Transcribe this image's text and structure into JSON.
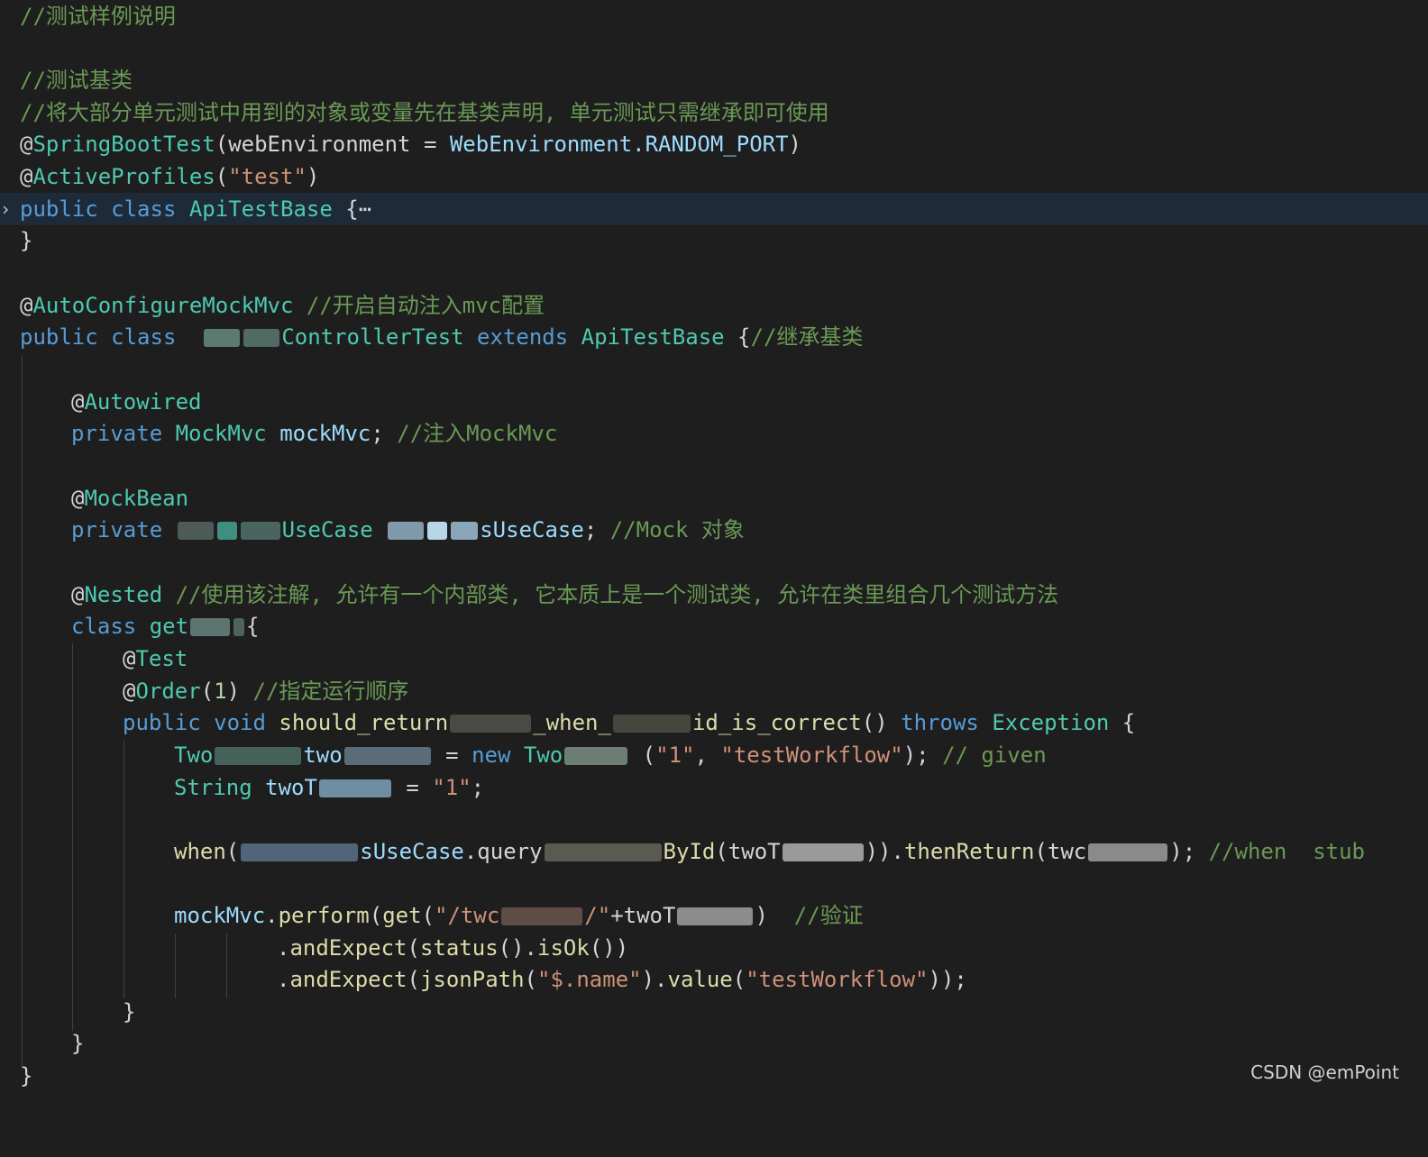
{
  "code_lines": {
    "l1": "//测试样例说明",
    "l3": "//测试基类",
    "l4": "//将大部分单元测试中用到的对象或变量先在基类声明, 单元测试只需继承即可使用",
    "l5": {
      "at": "@",
      "ann": "SpringBootTest",
      "a": "(",
      "b": "webEnvironment",
      "c": " = ",
      "d": "WebEnvironment",
      "e": ".RANDOM_PORT",
      "f": ")"
    },
    "l6": {
      "at": "@",
      "ann": "ActiveProfiles",
      "a": "(",
      "b": "\"test\"",
      "c": ")"
    },
    "l7": {
      "a": "public",
      "b": " ",
      "c": "class",
      "d": " ",
      "e": "ApiTestBase",
      "f": " {",
      "g": "⋯"
    },
    "l8": "}",
    "l10": {
      "at": "@",
      "ann": "AutoConfigureMockMvc",
      "c": " //开启自动注入mvc配置"
    },
    "l11": {
      "a": "public",
      "b": " ",
      "c": "class",
      "e": "ControllerTest",
      "f": " extends ",
      "g": "ApiTestBase",
      "h": " {",
      "i": "//继承基类"
    },
    "l13": {
      "at": "@",
      "ann": "Autowired"
    },
    "l14": {
      "a": "private",
      "b": " ",
      "c": "MockMvc",
      "d": " mockMvc",
      "e": ";",
      "f": " //注入MockMvc"
    },
    "l16": {
      "at": "@",
      "ann": "MockBean"
    },
    "l17": {
      "a": "private",
      "b": "UseCase",
      "c": "sUseCase",
      "d": ";",
      "e": " //Mock 对象"
    },
    "l19": {
      "at": "@",
      "ann": "Nested",
      "c": " //使用该注解, 允许有一个内部类, 它本质上是一个测试类, 允许在类里组合几个测试方法"
    },
    "l20": {
      "a": "class",
      "b": " get",
      "c": "{"
    },
    "l21": {
      "at": "@",
      "ann": "Test"
    },
    "l22": {
      "at": "@",
      "ann": "Order",
      "a": "(",
      "b": "1",
      "c": ")",
      "d": " //指定运行顺序"
    },
    "l23": {
      "a": "public",
      "b": " ",
      "c": "void",
      "d": " should_return",
      "e": "_when_",
      "f": "id_is_correct",
      "g": "() ",
      "h": "throws",
      "i": " ",
      "j": "Exception",
      "k": " {"
    },
    "l24": {
      "a": "Two",
      "b": "two",
      "c": " = ",
      "d": "new",
      "e": " Two",
      "f": " (",
      "g": "\"1\"",
      "h": ", ",
      "i": "\"testWorkflow\"",
      "j": "); ",
      "k": "// given"
    },
    "l25": {
      "a": "String",
      "b": " twoT",
      "c": " = ",
      "d": "\"1\"",
      "e": ";"
    },
    "l27": {
      "a": "when",
      "b": "(",
      "c": "sUseCase",
      "d": ".query",
      "e": "ById",
      "f": "(twoT",
      "g": ")).",
      "h": "thenReturn",
      "i": "(twc",
      "j": "); ",
      "k": "//when  stub"
    },
    "l29": {
      "a": "mockMvc",
      "b": ".",
      "c": "perform",
      "d": "(",
      "e": "get",
      "f": "(",
      "g": "\"/twc",
      "h": "/\"",
      "i": "+twoT",
      "j": ")",
      "k": "  //验证"
    },
    "l30": {
      "a": ".",
      "b": "andExpect",
      "c": "(",
      "d": "status",
      "e": "().",
      "f": "isOk",
      "g": "())"
    },
    "l31": {
      "a": ".",
      "b": "andExpect",
      "c": "(",
      "d": "jsonPath",
      "e": "(",
      "f": "\"$.name\"",
      "g": ").",
      "h": "value",
      "i": "(",
      "j": "\"testWorkflow\"",
      "k": "));"
    },
    "l32": "}",
    "l33": "}",
    "l34": "}"
  },
  "watermark": "CSDN @emPoint",
  "colors": {
    "background": "#1e1e1e",
    "keyword": "#569cd6",
    "type": "#4ec9b0",
    "identifier": "#9cdcfe",
    "string": "#ce9178",
    "number": "#b5cea8",
    "comment": "#6a9955",
    "function": "#dcdcaa",
    "highlight_line": "#1e2a38"
  }
}
